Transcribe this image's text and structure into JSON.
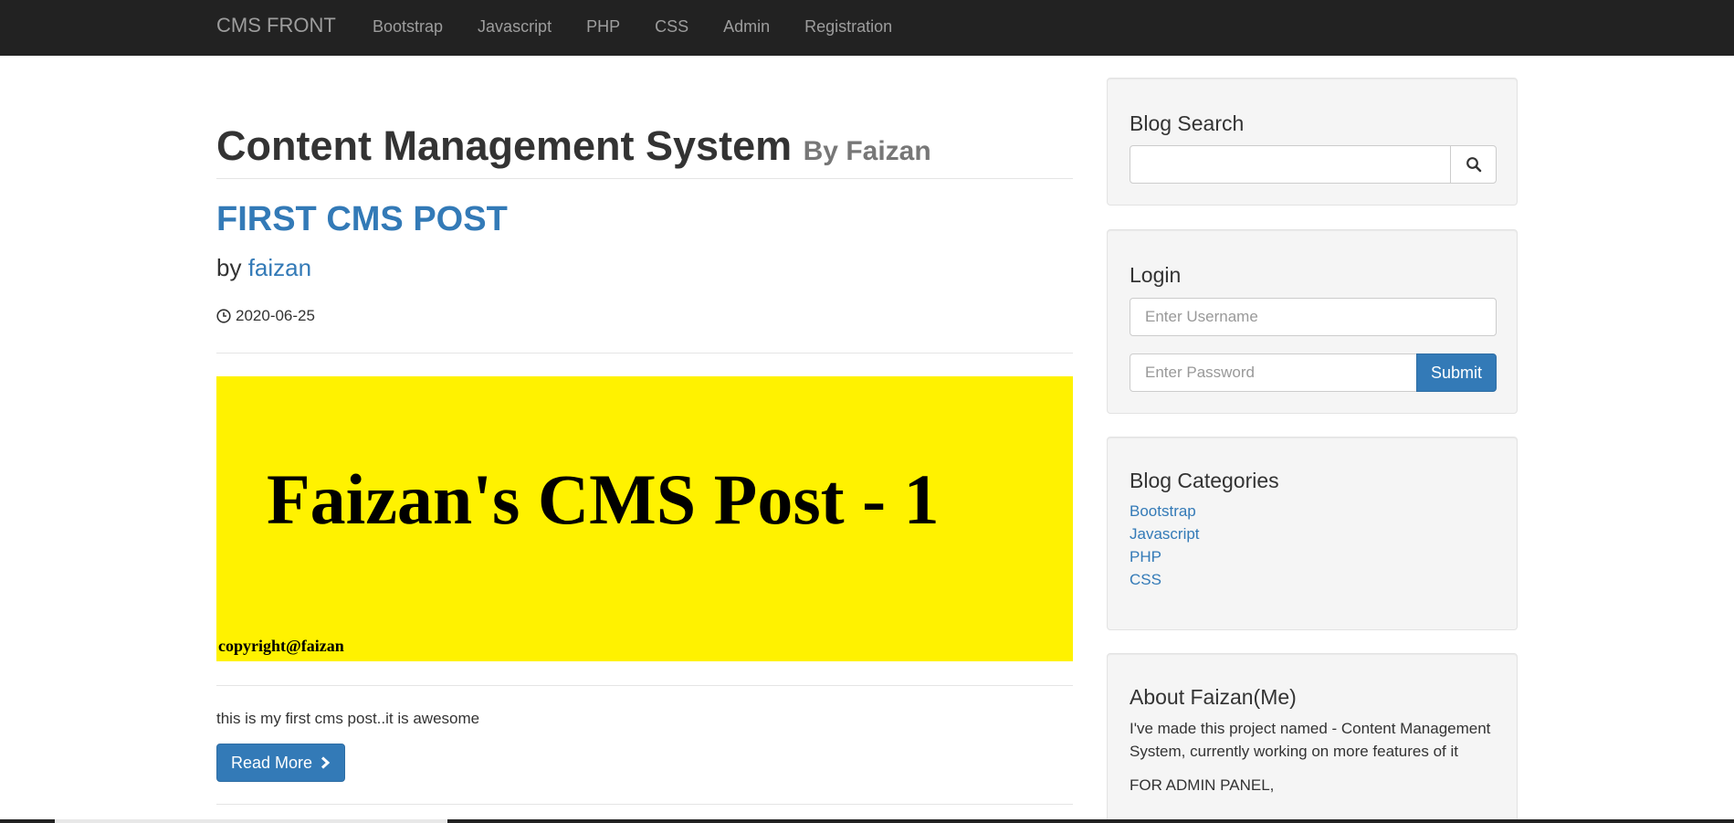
{
  "navbar": {
    "brand": "CMS FRONT",
    "links": [
      "Bootstrap",
      "Javascript",
      "PHP",
      "CSS",
      "Admin",
      "Registration"
    ]
  },
  "main": {
    "title": "Content Management System",
    "subtitle": "By Faizan",
    "post": {
      "title": "FIRST CMS POST",
      "by_label": "by",
      "author": "faizan",
      "date": "2020-06-25",
      "image_title": "Faizan's CMS Post - 1",
      "image_copyright": "copyright@faizan",
      "excerpt": "this is my first cms post..it is awesome",
      "read_more_label": "Read More"
    }
  },
  "sidebar": {
    "search": {
      "heading": "Blog Search",
      "value": "",
      "icon": "search-icon"
    },
    "login": {
      "heading": "Login",
      "username_placeholder": "Enter Username",
      "password_placeholder": "Enter Password",
      "submit_label": "Submit"
    },
    "categories": {
      "heading": "Blog Categories",
      "items": [
        "Bootstrap",
        "Javascript",
        "PHP",
        "CSS"
      ]
    },
    "about": {
      "heading": "About Faizan(Me)",
      "text": "I've made this project named - Content Management System, currently working on more features of it",
      "text2": "FOR ADMIN PANEL,"
    }
  },
  "colors": {
    "navbar_bg": "#222222",
    "link": "#337ab7",
    "primary_button": "#337ab7",
    "image_bg": "#fff200"
  }
}
